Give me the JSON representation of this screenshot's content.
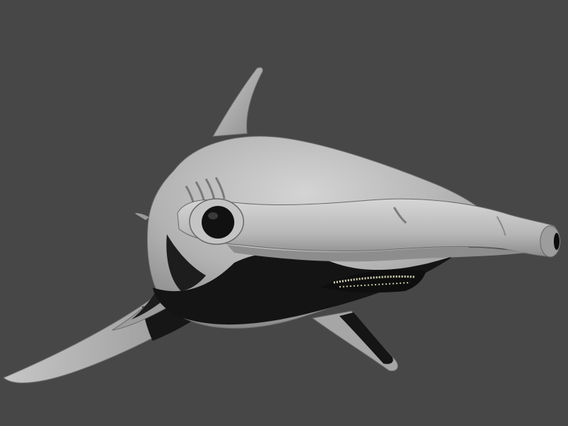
{
  "viewport": {
    "background_color": "#474747",
    "subject": "hammerhead-shark-3d-model",
    "model_base_color": "#b9b9b9",
    "model_shadow_color": "#1a1a1a",
    "teeth_color": "#d8d6b8"
  }
}
